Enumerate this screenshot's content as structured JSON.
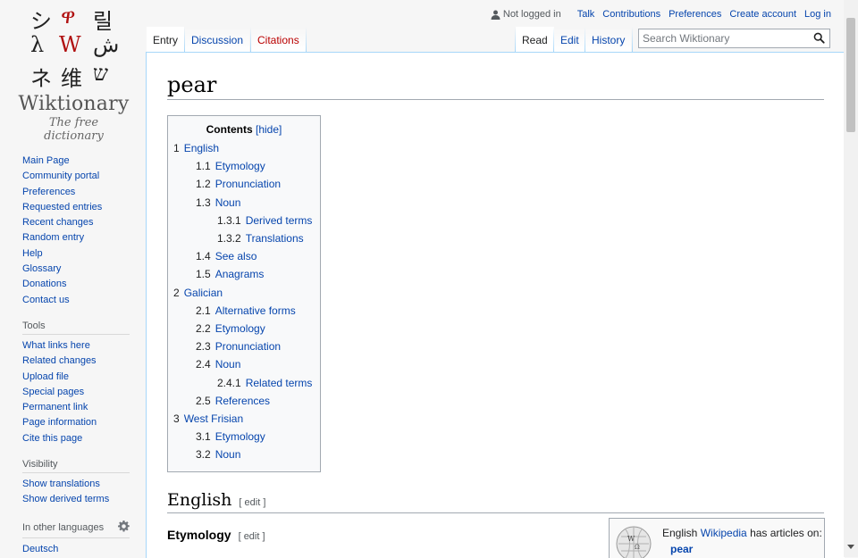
{
  "logo": {
    "wordmark": "Wiktionary",
    "tagline": "The free dictionary",
    "glyphs": [
      {
        "char": "シ",
        "red": false
      },
      {
        "char": "ዋ",
        "red": true
      },
      {
        "char": "릴",
        "red": false
      },
      {
        "char": "λ",
        "red": false
      },
      {
        "char": "W",
        "red": true
      },
      {
        "char": "ش",
        "red": false
      },
      {
        "char": "ネ",
        "red": false
      },
      {
        "char": "维",
        "red": false
      },
      {
        "char": "ש",
        "red": false
      }
    ]
  },
  "personal": {
    "status": "Not logged in",
    "links": [
      "Talk",
      "Contributions",
      "Preferences",
      "Create account",
      "Log in"
    ]
  },
  "tabs": {
    "left": [
      {
        "label": "Entry",
        "selected": true,
        "missing": false
      },
      {
        "label": "Discussion",
        "selected": false,
        "missing": false
      },
      {
        "label": "Citations",
        "selected": false,
        "missing": true
      }
    ],
    "right": [
      {
        "label": "Read",
        "selected": true
      },
      {
        "label": "Edit",
        "selected": false
      },
      {
        "label": "History",
        "selected": false
      }
    ]
  },
  "search": {
    "placeholder": "Search Wiktionary"
  },
  "sidebar": {
    "nav": [
      "Main Page",
      "Community portal",
      "Preferences",
      "Requested entries",
      "Recent changes",
      "Random entry",
      "Help",
      "Glossary",
      "Donations",
      "Contact us"
    ],
    "tools_heading": "Tools",
    "tools": [
      "What links here",
      "Related changes",
      "Upload file",
      "Special pages",
      "Permanent link",
      "Page information",
      "Cite this page"
    ],
    "visibility_heading": "Visibility",
    "visibility": [
      "Show translations",
      "Show derived terms"
    ],
    "languages_heading": "In other languages",
    "languages": [
      "Deutsch"
    ]
  },
  "page": {
    "title": "pear",
    "toc": {
      "title": "Contents",
      "toggle": "[hide]",
      "items": [
        {
          "num": "1",
          "text": "English",
          "level": 1
        },
        {
          "num": "1.1",
          "text": "Etymology",
          "level": 2
        },
        {
          "num": "1.2",
          "text": "Pronunciation",
          "level": 2
        },
        {
          "num": "1.3",
          "text": "Noun",
          "level": 2
        },
        {
          "num": "1.3.1",
          "text": "Derived terms",
          "level": 3
        },
        {
          "num": "1.3.2",
          "text": "Translations",
          "level": 3
        },
        {
          "num": "1.4",
          "text": "See also",
          "level": 2
        },
        {
          "num": "1.5",
          "text": "Anagrams",
          "level": 2
        },
        {
          "num": "2",
          "text": "Galician",
          "level": 1
        },
        {
          "num": "2.1",
          "text": "Alternative forms",
          "level": 2
        },
        {
          "num": "2.2",
          "text": "Etymology",
          "level": 2
        },
        {
          "num": "2.3",
          "text": "Pronunciation",
          "level": 2
        },
        {
          "num": "2.4",
          "text": "Noun",
          "level": 2
        },
        {
          "num": "2.4.1",
          "text": "Related terms",
          "level": 3
        },
        {
          "num": "2.5",
          "text": "References",
          "level": 2
        },
        {
          "num": "3",
          "text": "West Frisian",
          "level": 1
        },
        {
          "num": "3.1",
          "text": "Etymology",
          "level": 2
        },
        {
          "num": "3.2",
          "text": "Noun",
          "level": 2
        }
      ]
    },
    "sections": {
      "english": {
        "heading": "English",
        "edit": "[ edit ]"
      },
      "etymology": {
        "heading": "Etymology",
        "edit": "[ edit ]"
      }
    },
    "wikipedia_box": {
      "prefix": "English",
      "link": "Wikipedia",
      "suffix": "has articles on:",
      "article": "pear"
    }
  }
}
